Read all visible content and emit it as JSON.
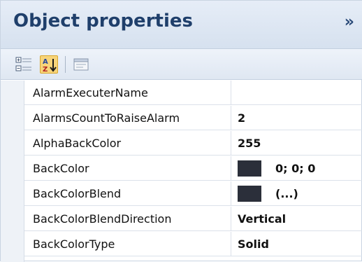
{
  "header": {
    "title": "Object properties",
    "collapse_glyph": "»"
  },
  "toolbar": {
    "categorized_icon": "categorized-icon",
    "alphabetical_icon": "alphabetical-sort-icon",
    "property_pages_icon": "property-pages-icon"
  },
  "properties": [
    {
      "name": "AlarmExecuterName",
      "value": ""
    },
    {
      "name": "AlarmsCountToRaiseAlarm",
      "value": "2"
    },
    {
      "name": "AlphaBackColor",
      "value": "255"
    },
    {
      "name": "BackColor",
      "value": "0; 0; 0",
      "swatch": "#2b2f3a"
    },
    {
      "name": "BackColorBlend",
      "value": "(...)",
      "swatch": "#2b2f3a"
    },
    {
      "name": "BackColorBlendDirection",
      "value": "Vertical"
    },
    {
      "name": "BackColorType",
      "value": "Solid"
    }
  ]
}
